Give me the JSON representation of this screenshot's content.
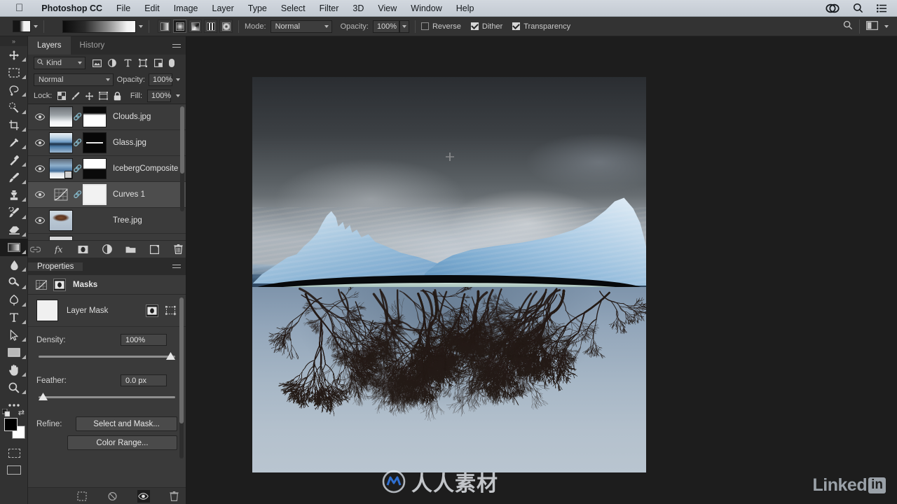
{
  "menubar": {
    "apple_icon": "apple-icon",
    "app_name": "Photoshop CC",
    "items": [
      "File",
      "Edit",
      "Image",
      "Layer",
      "Type",
      "Select",
      "Filter",
      "3D",
      "View",
      "Window",
      "Help"
    ],
    "status_icons": [
      "creative-cloud-icon",
      "spotlight-search-icon",
      "control-center-icon"
    ]
  },
  "options_bar": {
    "gradient_preset_label": "gradient-preset-swatch",
    "gradient_types": [
      "linear-gradient",
      "radial-gradient",
      "angle-gradient",
      "reflected-gradient",
      "diamond-gradient"
    ],
    "gradient_type_selected_index": 1,
    "mode_label": "Mode:",
    "mode_value": "Normal",
    "opacity_label": "Opacity:",
    "opacity_value": "100%",
    "reverse_label": "Reverse",
    "reverse_checked": false,
    "dither_label": "Dither",
    "dither_checked": true,
    "transparency_label": "Transparency",
    "transparency_checked": true,
    "right_icons": [
      "search-icon",
      "workspace-switcher-icon",
      "chevron-down-icon"
    ]
  },
  "toolbar": {
    "grip": "»",
    "tools": [
      {
        "name": "move-tool",
        "selected": false
      },
      {
        "name": "rectangular-marquee-tool",
        "selected": false
      },
      {
        "name": "lasso-tool",
        "selected": false
      },
      {
        "name": "quick-selection-tool",
        "selected": false
      },
      {
        "name": "crop-tool",
        "selected": false
      },
      {
        "name": "eyedropper-tool",
        "selected": false
      },
      {
        "name": "spot-healing-brush-tool",
        "selected": false
      },
      {
        "name": "brush-tool",
        "selected": false
      },
      {
        "name": "clone-stamp-tool",
        "selected": false
      },
      {
        "name": "history-brush-tool",
        "selected": false
      },
      {
        "name": "eraser-tool",
        "selected": false
      },
      {
        "name": "gradient-tool",
        "selected": true
      },
      {
        "name": "blur-tool",
        "selected": false
      },
      {
        "name": "dodge-tool",
        "selected": false
      },
      {
        "name": "pen-tool",
        "selected": false
      },
      {
        "name": "type-tool",
        "selected": false
      },
      {
        "name": "path-selection-tool",
        "selected": false
      },
      {
        "name": "rectangle-tool",
        "selected": false
      },
      {
        "name": "hand-tool",
        "selected": false
      },
      {
        "name": "zoom-tool",
        "selected": false
      },
      {
        "name": "edit-toolbar-tool",
        "selected": false
      }
    ],
    "foreground_color": "#000000",
    "background_color": "#ffffff",
    "quick_mask_label": "quick-mask-mode",
    "screen_mode_label": "screen-mode"
  },
  "layers_panel": {
    "tabs": [
      {
        "label": "Layers",
        "active": true
      },
      {
        "label": "History",
        "active": false
      }
    ],
    "filter_kind_label": "Kind",
    "filter_icons": [
      "pixel-filter-icon",
      "adjustment-filter-icon",
      "type-filter-icon",
      "shape-filter-icon",
      "smart-object-filter-icon",
      "filter-toggle-switch"
    ],
    "blend_mode": "Normal",
    "opacity_label": "Opacity:",
    "opacity_value": "100%",
    "lock_label": "Lock:",
    "lock_icons": [
      "lock-transparent-pixels-icon",
      "lock-image-pixels-icon",
      "lock-position-icon",
      "lock-artboard-nesting-icon",
      "lock-all-icon"
    ],
    "fill_label": "Fill:",
    "fill_value": "100%",
    "layers": [
      {
        "name": "Clouds.jpg",
        "visible": true,
        "selected": false,
        "kind": "image",
        "has_mask": true,
        "linked": true
      },
      {
        "name": "Glass.jpg",
        "visible": true,
        "selected": false,
        "kind": "image",
        "has_mask": true,
        "linked": true
      },
      {
        "name": "IcebergComposite",
        "visible": true,
        "selected": false,
        "kind": "smart-object",
        "has_mask": true,
        "linked": true
      },
      {
        "name": "Curves 1",
        "visible": true,
        "selected": true,
        "kind": "adjustment-curves",
        "has_mask": true,
        "linked": true,
        "mask_active": true
      },
      {
        "name": "Tree.jpg",
        "visible": true,
        "selected": false,
        "kind": "image",
        "has_mask": false,
        "linked": false
      }
    ],
    "footer_icons": [
      "link-layers-icon",
      "add-layer-style-icon",
      "add-layer-mask-icon",
      "new-adjustment-layer-icon",
      "new-group-icon",
      "new-layer-icon",
      "delete-layer-icon"
    ]
  },
  "properties_panel": {
    "tab_label": "Properties",
    "mode_tabs": [
      "curves-properties-icon",
      "masks-properties-icon"
    ],
    "masks_label": "Masks",
    "layer_mask_label": "Layer Mask",
    "layer_mask_buttons": [
      "pixel-mask-icon",
      "vector-mask-icon"
    ],
    "density_label": "Density:",
    "density_value": "100%",
    "density_percent": 100,
    "feather_label": "Feather:",
    "feather_value": "0.0 px",
    "feather_percent": 0,
    "refine_label": "Refine:",
    "select_and_mask_label": "Select and Mask...",
    "color_range_label": "Color Range...",
    "footer_icons": [
      "load-selection-from-mask-icon",
      "apply-mask-icon",
      "toggle-mask-visibility-icon",
      "delete-mask-icon"
    ]
  },
  "canvas": {
    "document_description": "Iceberg composite: stormy clouds over blue iceberg above waterline, dark tree roots submerged below",
    "cursor": "gradient-crosshair-cursor"
  },
  "watermarks": {
    "center_text": "人人素材",
    "center_logo": "renren-logo-icon",
    "brand_text": "Linked",
    "brand_suffix": "in",
    "tiled_text": "人人素材"
  },
  "colors": {
    "menubar_bg": "#cdd4db",
    "panel_bg": "#323232",
    "panel_alt_bg": "#3b3b3b",
    "selection_bg": "#4d4d4d",
    "stage_bg": "#1d1d1d",
    "text": "#cfcfcf"
  }
}
